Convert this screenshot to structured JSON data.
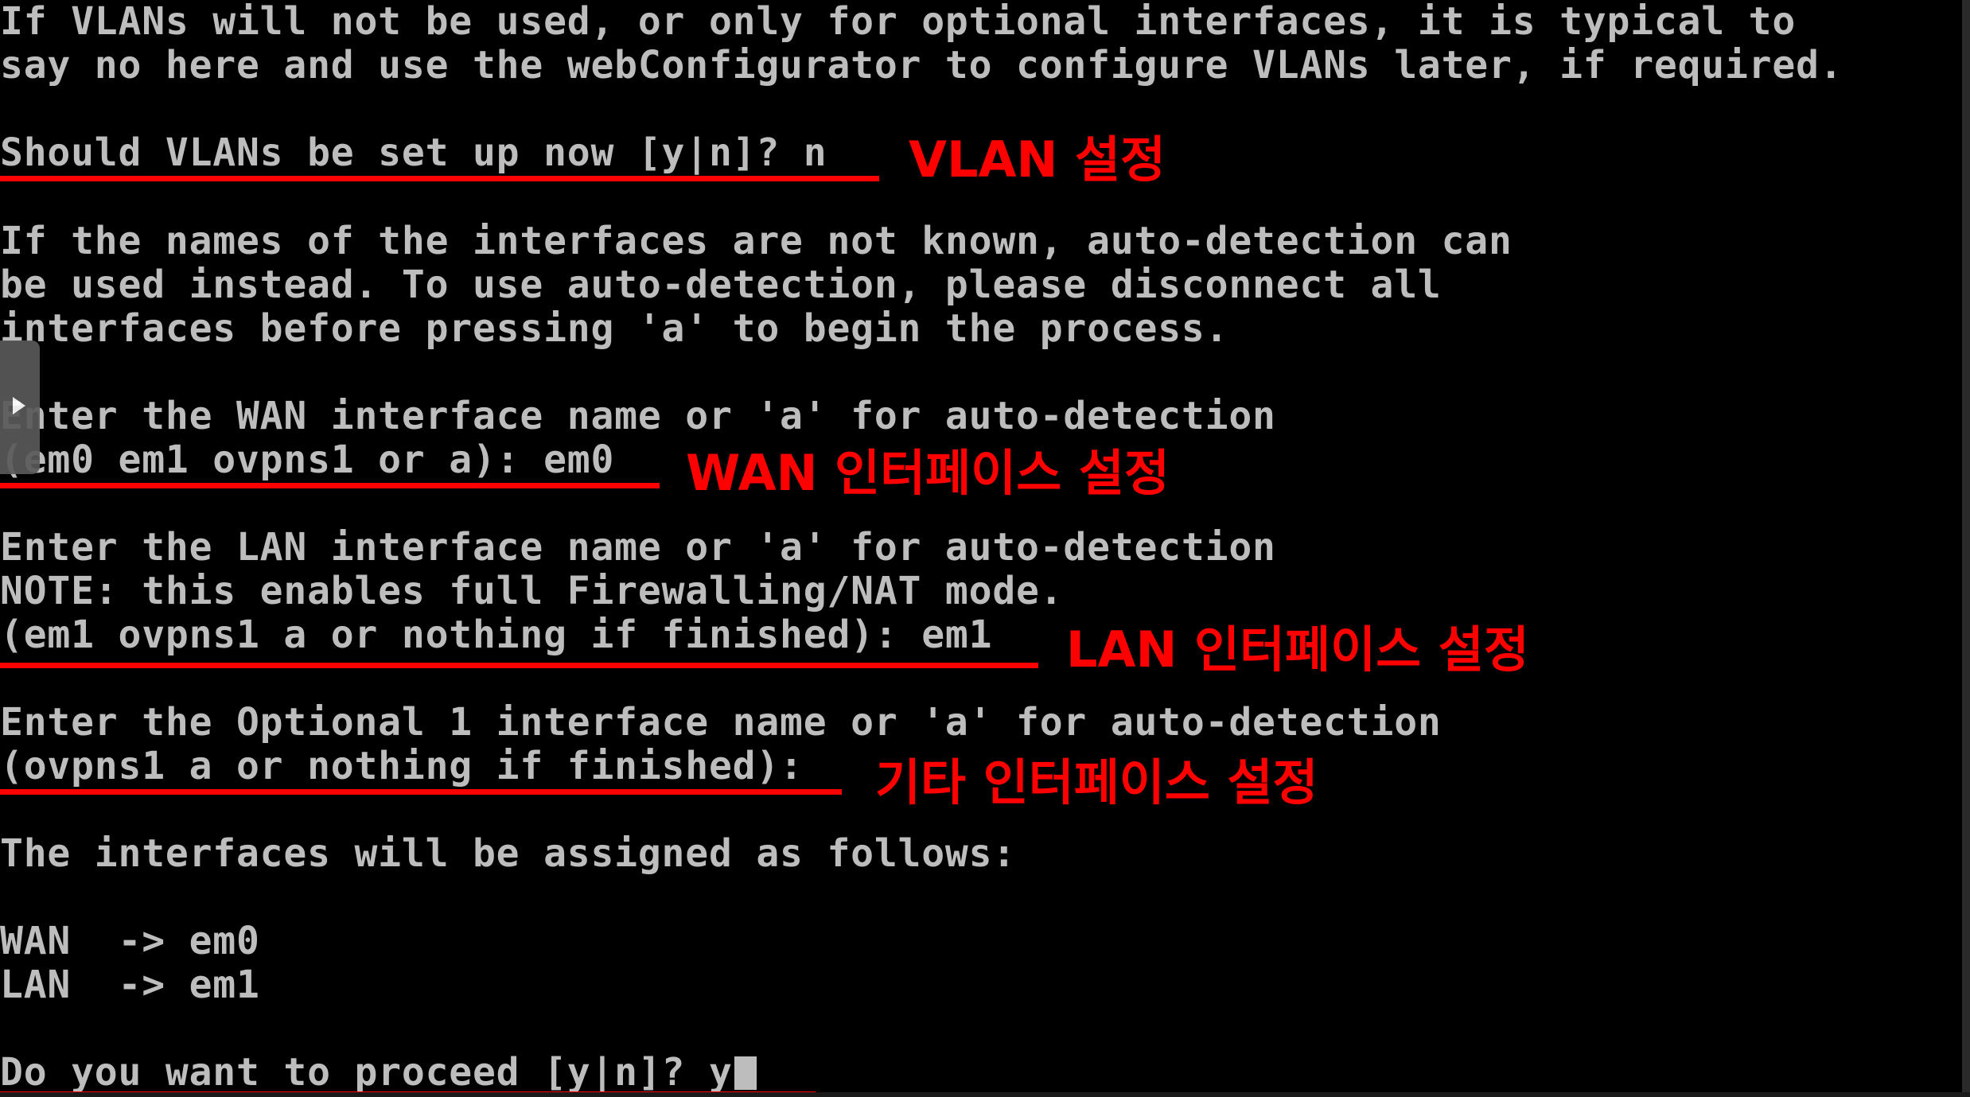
{
  "console": {
    "lines": [
      "If VLANs will not be used, or only for optional interfaces, it is typical to",
      "say no here and use the webConfigurator to configure VLANs later, if required.",
      "Should VLANs be set up now [y|n]? n",
      "If the names of the interfaces are not known, auto-detection can",
      "be used instead. To use auto-detection, please disconnect all",
      "interfaces before pressing 'a' to begin the process.",
      "Enter the WAN interface name or 'a' for auto-detection",
      "(em0 em1 ovpns1 or a): em0",
      "Enter the LAN interface name or 'a' for auto-detection",
      "NOTE: this enables full Firewalling/NAT mode.",
      "(em1 ovpns1 a or nothing if finished): em1",
      "Enter the Optional 1 interface name or 'a' for auto-detection",
      "(ovpns1 a or nothing if finished):",
      "The interfaces will be assigned as follows:",
      "WAN  -> em0",
      "LAN  -> em1",
      "Do you want to proceed [y|n]? y"
    ]
  },
  "annotations": {
    "vlan": "VLAN 설정",
    "wan": "WAN 인터페이스 설정",
    "lan": "LAN 인터페이스 설정",
    "optional": "기타 인터페이스 설정"
  },
  "colors": {
    "background": "#000000",
    "terminal_text": "#bdbdbd",
    "annotation": "#ff0000"
  },
  "icons": {
    "side_handle": "play-icon"
  }
}
